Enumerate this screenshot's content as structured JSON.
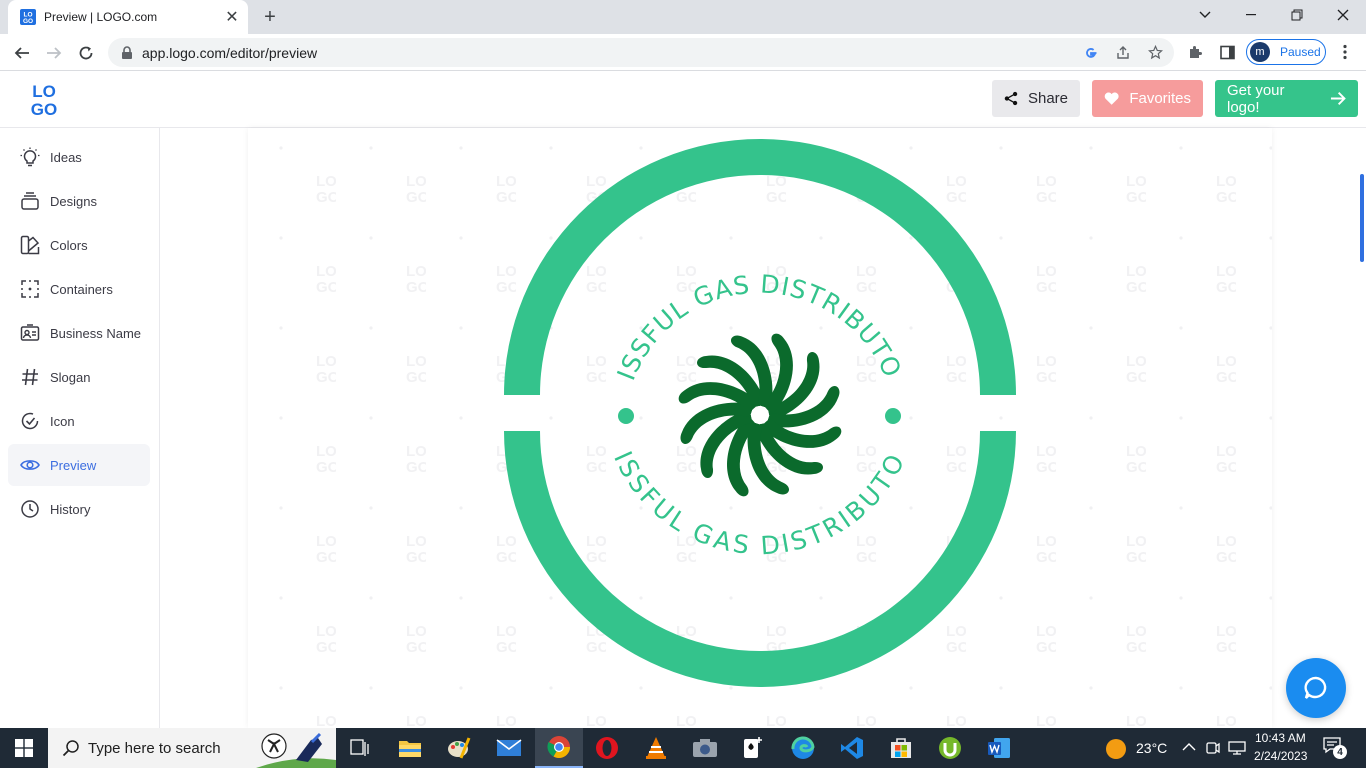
{
  "browser": {
    "tab_title": "Preview | LOGO.com",
    "url": "app.logo.com/editor/preview",
    "profile_initial": "m",
    "profile_status": "Paused"
  },
  "header": {
    "logo_top": "LO",
    "logo_bottom": "GO",
    "share_label": "Share",
    "favorites_label": "Favorites",
    "get_logo_label": "Get your logo!"
  },
  "sidebar": {
    "items": [
      {
        "label": "Ideas",
        "icon": "lightbulb-icon"
      },
      {
        "label": "Designs",
        "icon": "layers-icon"
      },
      {
        "label": "Colors",
        "icon": "palette-icon"
      },
      {
        "label": "Containers",
        "icon": "container-icon"
      },
      {
        "label": "Business Name",
        "icon": "id-card-icon"
      },
      {
        "label": "Slogan",
        "icon": "hashtag-icon"
      },
      {
        "label": "Icon",
        "icon": "check-circle-icon"
      },
      {
        "label": "Preview",
        "icon": "eye-icon",
        "active": true
      },
      {
        "label": "History",
        "icon": "clock-icon"
      }
    ]
  },
  "logo_design": {
    "business_name_top": "BLISSFUL GAS DISTRIBUTORS",
    "business_name_bottom": "BLISSFUL GAS DISTRIBUTORS",
    "ring_color": "#34c38c",
    "icon_color": "#0b6a2c",
    "watermark": "LOGO"
  },
  "taskbar": {
    "search_placeholder": "Type here to search",
    "temperature": "23°C",
    "time": "10:43 AM",
    "date": "2/24/2023",
    "notification_count": "4"
  },
  "colors": {
    "accent_blue": "#3c6ee0",
    "brand_green": "#35c48b",
    "favorites_pink": "#f69c9c"
  }
}
